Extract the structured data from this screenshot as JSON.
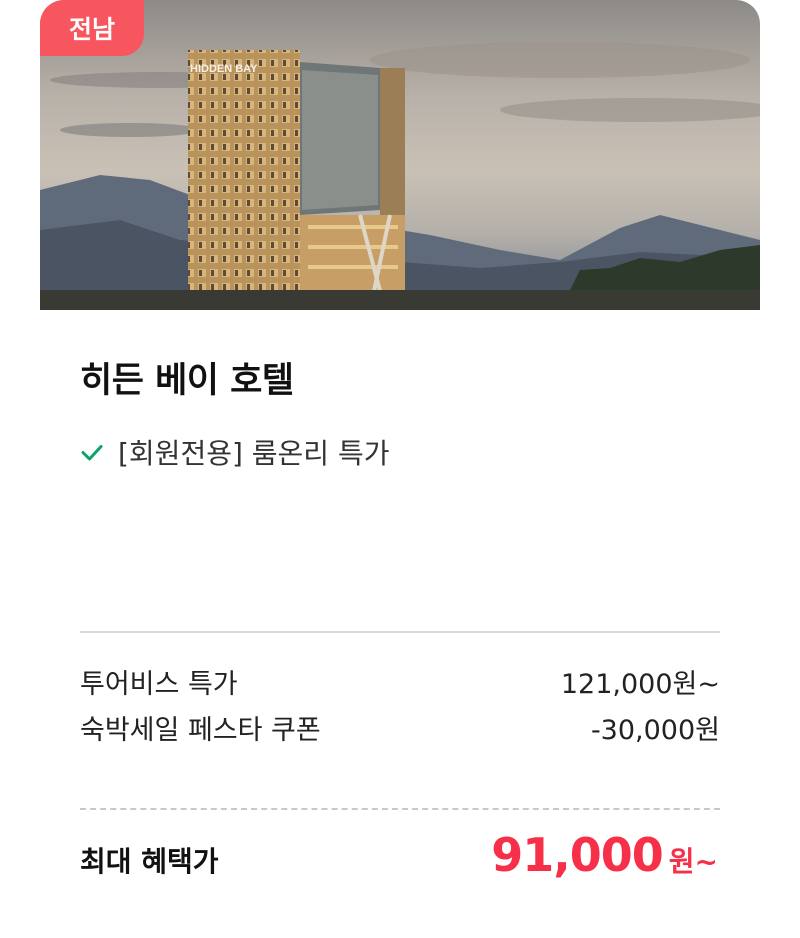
{
  "badge": {
    "region": "전남"
  },
  "hero": {
    "sign_text": "HIDDEN BAY",
    "image": "hotel-building-photo"
  },
  "hotel": {
    "name": "히든 베이 호텔"
  },
  "benefit": {
    "icon": "check-icon",
    "text": "[회원전용] 룸온리 특가"
  },
  "prices": {
    "rows": [
      {
        "label": "투어비스 특가",
        "value": "121,000원~"
      },
      {
        "label": "숙박세일 페스타 쿠폰",
        "value": "-30,000원"
      }
    ],
    "final": {
      "label": "최대 혜택가",
      "amount": "91,000",
      "unit": "원~"
    }
  },
  "colors": {
    "badge": "#f7565f",
    "accent": "#f7304a",
    "check": "#0aa36a"
  }
}
